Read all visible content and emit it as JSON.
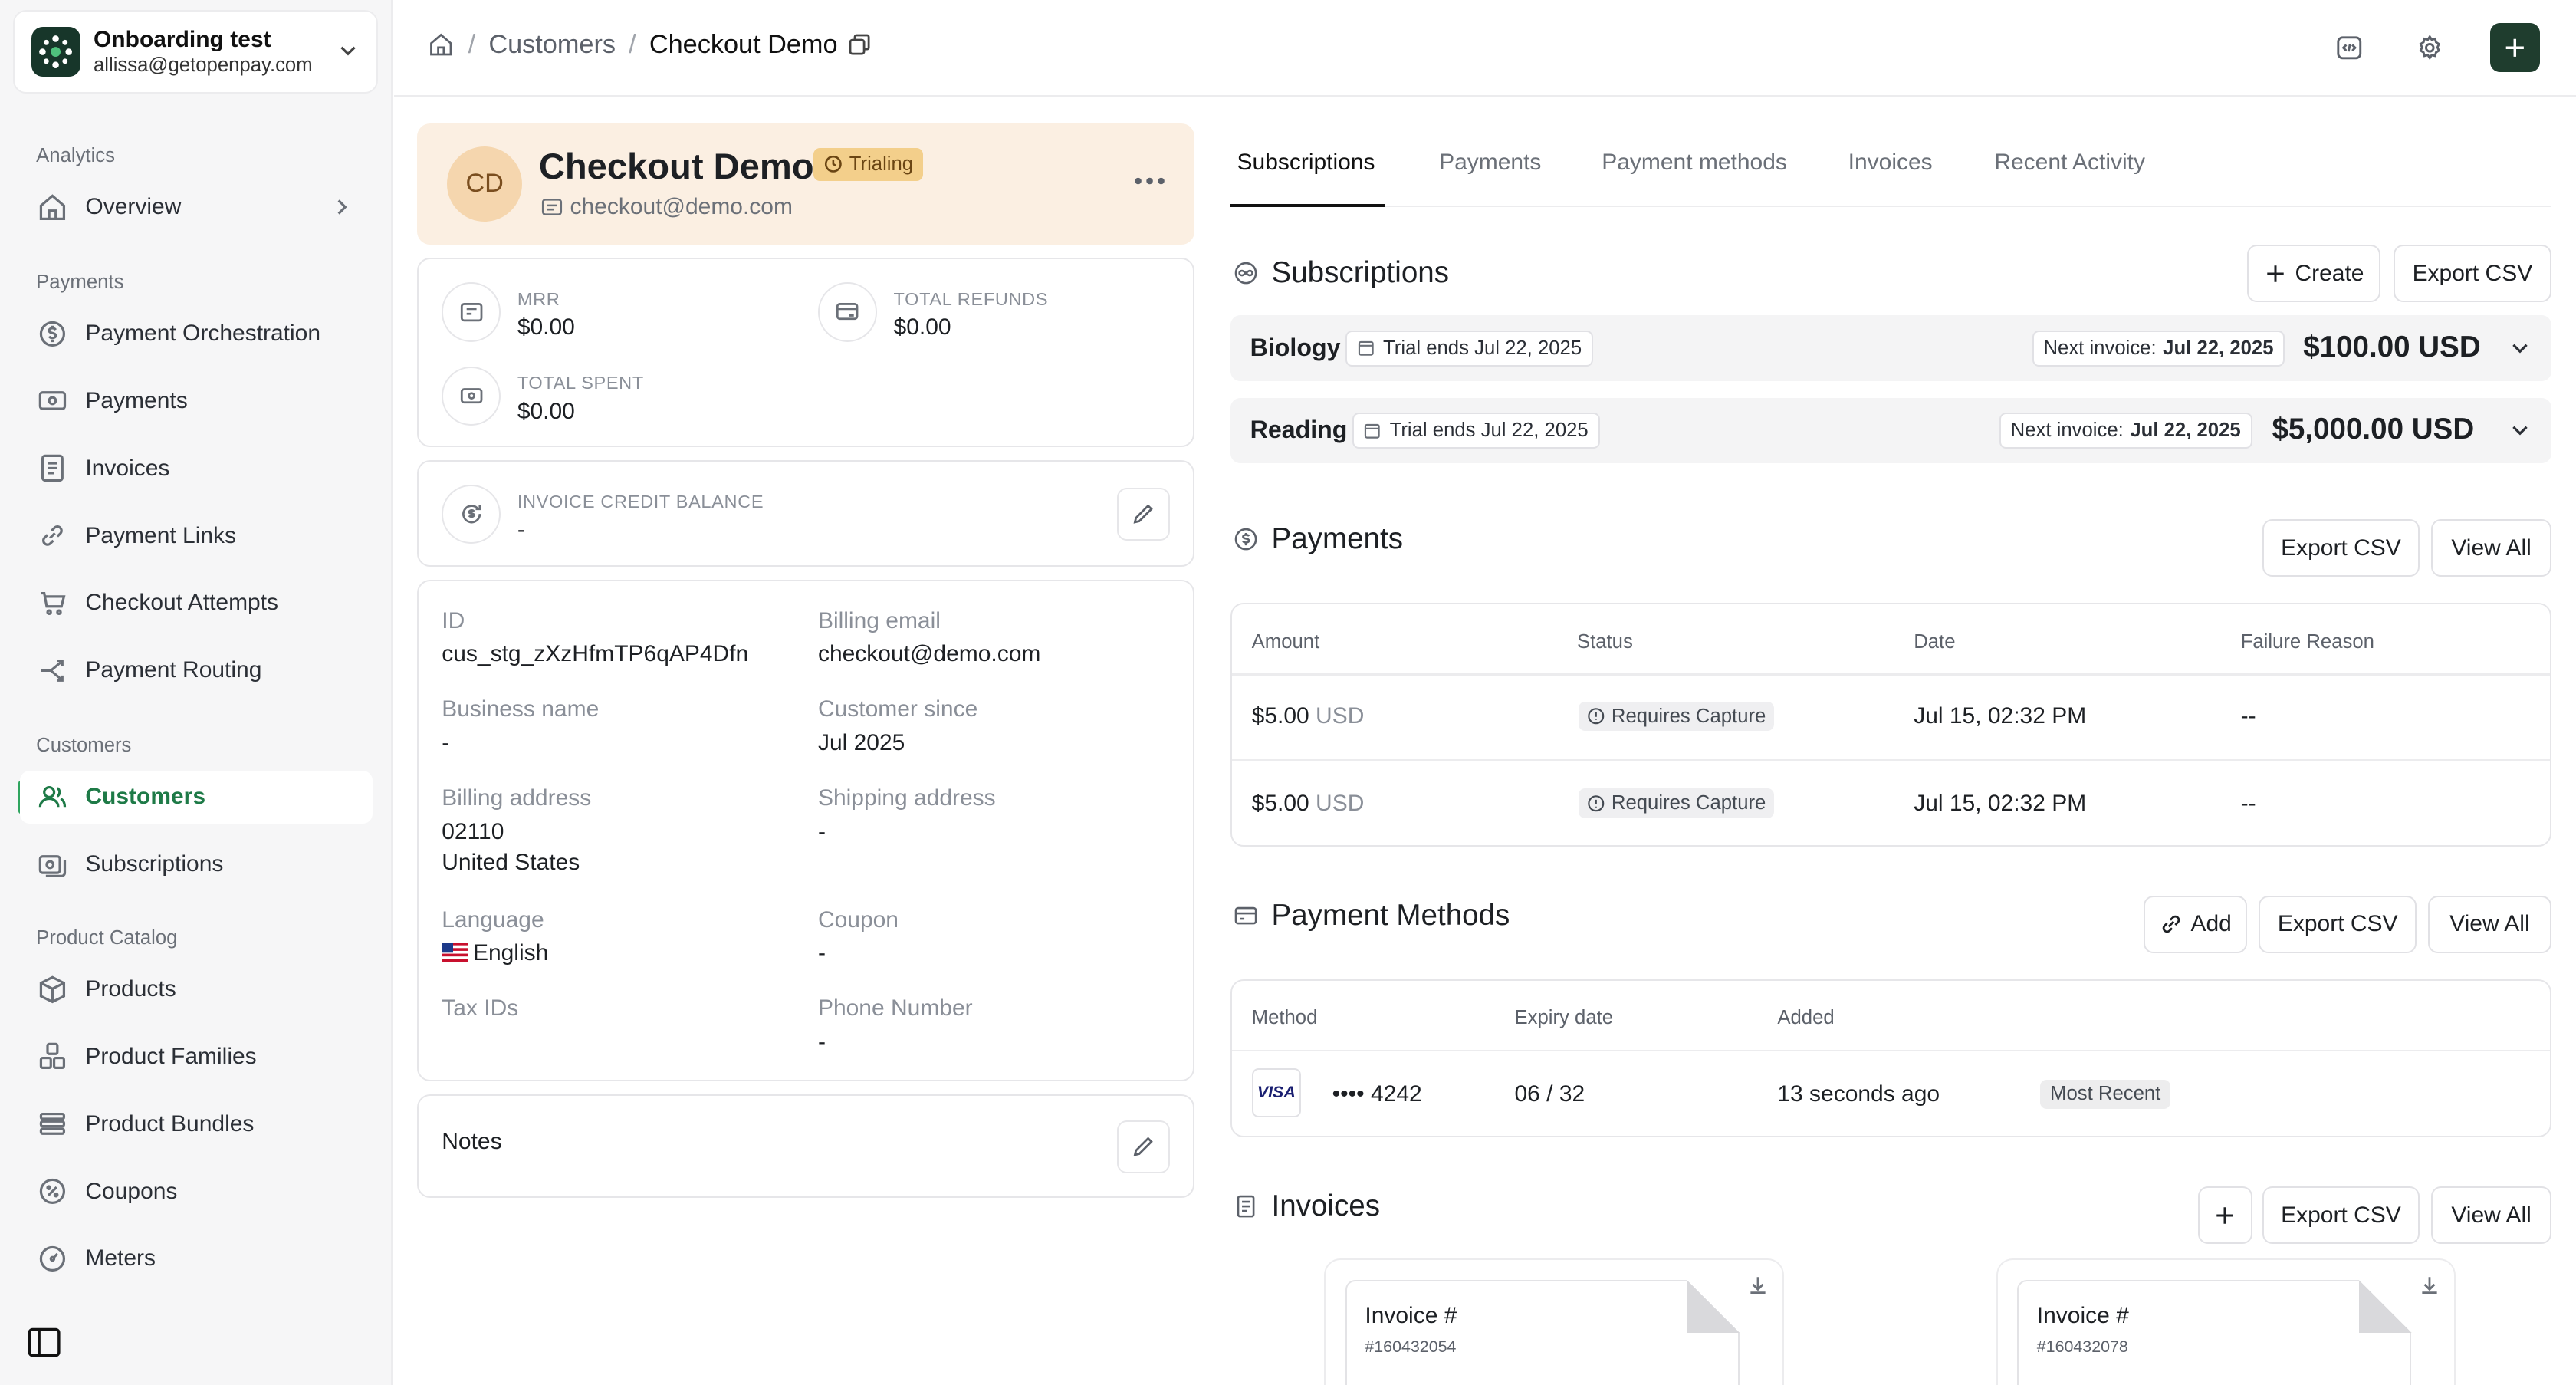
{
  "org": {
    "name": "Onboarding test",
    "email": "allissa@getopenpay.com"
  },
  "sidebar": {
    "sections": [
      {
        "title": "Analytics"
      },
      {
        "title": "Payments"
      },
      {
        "title": "Customers"
      },
      {
        "title": "Product Catalog"
      }
    ],
    "items": [
      {
        "label": "Overview",
        "icon": "home-icon"
      },
      {
        "label": "Payment Orchestration",
        "icon": "dollar-cycle-icon"
      },
      {
        "label": "Payments",
        "icon": "banknote-icon"
      },
      {
        "label": "Invoices",
        "icon": "document-icon"
      },
      {
        "label": "Payment Links",
        "icon": "link-icon"
      },
      {
        "label": "Checkout Attempts",
        "icon": "cart-icon"
      },
      {
        "label": "Payment Routing",
        "icon": "routing-icon"
      },
      {
        "label": "Customers",
        "icon": "users-icon"
      },
      {
        "label": "Subscriptions",
        "icon": "subscriptions-icon"
      },
      {
        "label": "Products",
        "icon": "box-icon"
      },
      {
        "label": "Product Families",
        "icon": "boxes-icon"
      },
      {
        "label": "Product Bundles",
        "icon": "layers-icon"
      },
      {
        "label": "Coupons",
        "icon": "coupon-icon"
      },
      {
        "label": "Meters",
        "icon": "gauge-icon"
      }
    ]
  },
  "breadcrumb": {
    "parent": "Customers",
    "current": "Checkout Demo"
  },
  "customer": {
    "initials": "CD",
    "name": "Checkout Demo",
    "status": "Trialing",
    "email": "checkout@demo.com"
  },
  "stats": {
    "mrr_label": "MRR",
    "mrr_value": "$0.00",
    "refunds_label": "TOTAL REFUNDS",
    "refunds_value": "$0.00",
    "spent_label": "TOTAL SPENT",
    "spent_value": "$0.00",
    "credit_label": "INVOICE CREDIT BALANCE",
    "credit_value": "-"
  },
  "details": {
    "id_label": "ID",
    "id_value": "cus_stg_zXzHfmTP6qAP4Dfn",
    "billing_email_label": "Billing email",
    "billing_email_value": "checkout@demo.com",
    "business_label": "Business name",
    "business_value": "-",
    "since_label": "Customer since",
    "since_value": "Jul 2025",
    "billing_addr_label": "Billing address",
    "billing_addr_line1": "02110",
    "billing_addr_line2": "United States",
    "shipping_label": "Shipping address",
    "shipping_value": "-",
    "language_label": "Language",
    "language_value": "English",
    "coupon_label": "Coupon",
    "coupon_value": "-",
    "tax_label": "Tax IDs",
    "phone_label": "Phone Number",
    "phone_value": "-"
  },
  "notes": {
    "label": "Notes"
  },
  "tabs": [
    "Subscriptions",
    "Payments",
    "Payment methods",
    "Invoices",
    "Recent Activity"
  ],
  "subscriptions": {
    "title": "Subscriptions",
    "create_label": "Create",
    "export_label": "Export CSV",
    "rows": [
      {
        "name": "Biology",
        "trial": "Trial ends Jul 22, 2025",
        "next_label": "Next invoice:",
        "next_date": "Jul 22, 2025",
        "amount": "$100.00 USD"
      },
      {
        "name": "Reading",
        "trial": "Trial ends Jul 22, 2025",
        "next_label": "Next invoice:",
        "next_date": "Jul 22, 2025",
        "amount": "$5,000.00 USD"
      }
    ]
  },
  "payments": {
    "title": "Payments",
    "export_label": "Export CSV",
    "view_all_label": "View All",
    "columns": [
      "Amount",
      "Status",
      "Date",
      "Failure Reason"
    ],
    "rows": [
      {
        "amount": "$5.00",
        "currency": "USD",
        "status": "Requires Capture",
        "date": "Jul 15, 02:32 PM",
        "failure": "--"
      },
      {
        "amount": "$5.00",
        "currency": "USD",
        "status": "Requires Capture",
        "date": "Jul 15, 02:32 PM",
        "failure": "--"
      }
    ]
  },
  "payment_methods": {
    "title": "Payment Methods",
    "add_label": "Add",
    "export_label": "Export CSV",
    "view_all_label": "View All",
    "columns": [
      "Method",
      "Expiry date",
      "Added"
    ],
    "rows": [
      {
        "brand": "VISA",
        "last4": "•••• 4242",
        "expiry": "06 / 32",
        "added": "13 seconds ago",
        "badge": "Most Recent"
      }
    ]
  },
  "invoices": {
    "title": "Invoices",
    "export_label": "Export CSV",
    "view_all_label": "View All",
    "cards": [
      {
        "title": "Invoice #",
        "number": "#160432054"
      },
      {
        "title": "Invoice #",
        "number": "#160432078"
      }
    ]
  },
  "colors": {
    "accent": "#1e7a47",
    "profile_bg": "#fbefe2",
    "trial_badge": "#f3cf8b",
    "add_button": "#1f3d2e"
  }
}
